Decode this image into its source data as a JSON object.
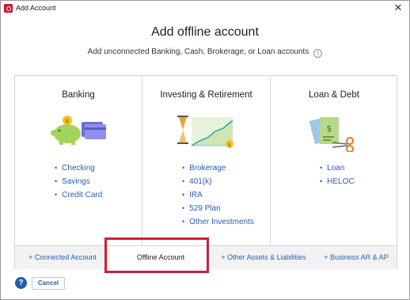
{
  "window": {
    "title": "Add Account",
    "close_glyph": "✕"
  },
  "header": {
    "title": "Add offline account",
    "subtitle": "Add unconnected Banking, Cash, Brokerage, or Loan accounts",
    "info_glyph": "i"
  },
  "columns": [
    {
      "title": "Banking",
      "icon": "piggy-bank-card-icon",
      "items": [
        "Checking",
        "Savings",
        "Credit Card"
      ]
    },
    {
      "title": "Investing & Retirement",
      "icon": "hourglass-growth-chart-icon",
      "items": [
        "Brokerage",
        "401(k)",
        "IRA",
        "529 Plan",
        "Other Investments"
      ]
    },
    {
      "title": "Loan & Debt",
      "icon": "cutting-bills-scissors-icon",
      "items": [
        "Loan",
        "HELOC"
      ]
    }
  ],
  "tabs": [
    {
      "label": "+ Connected Account",
      "active": false
    },
    {
      "label": "Offline Account",
      "active": true
    },
    {
      "label": "+ Other Assets & Liabilities",
      "active": false
    },
    {
      "label": "+ Business AR & AP",
      "active": false
    }
  ],
  "footer": {
    "help_glyph": "?",
    "cancel_label": "Cancel"
  },
  "colors": {
    "brand_red": "#d3102d",
    "link_blue": "#2a5db0",
    "highlight_red": "#c8203a",
    "accent_green": "#8dc63f"
  }
}
